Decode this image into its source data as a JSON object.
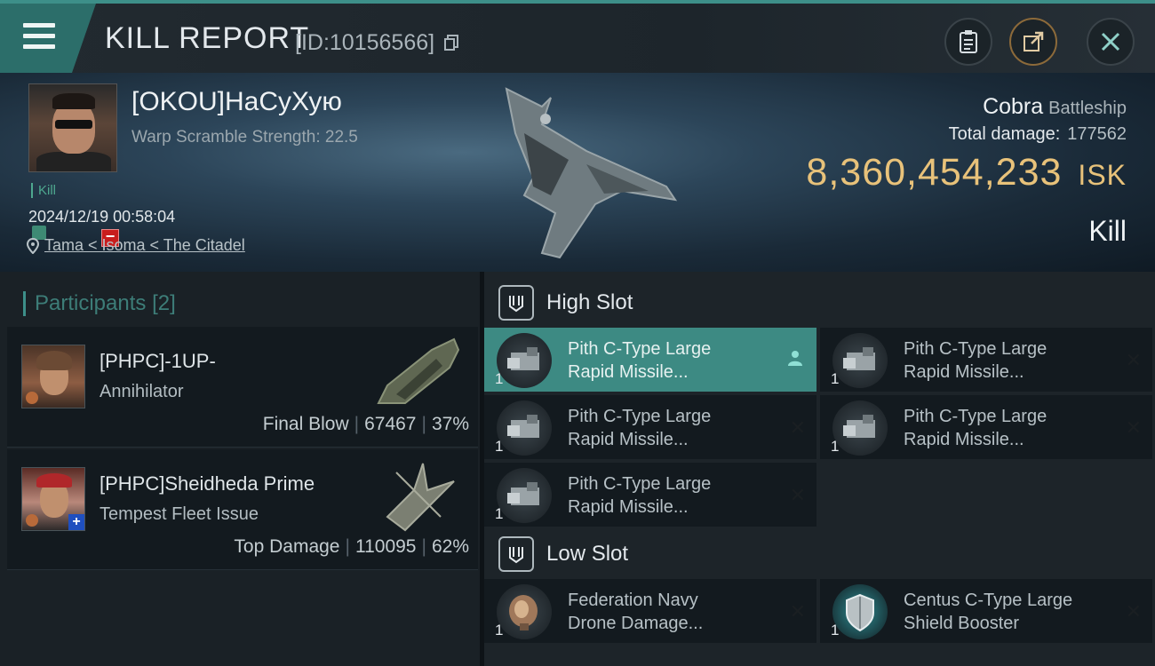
{
  "header": {
    "title": "KILL REPORT",
    "report_id": "[ID:10156566]"
  },
  "victim": {
    "name": "[OKOU]НаСуХую",
    "warp_scramble": "Warp Scramble Strength: 22.5",
    "tag": "Kill",
    "datetime": "2024/12/19 00:58:04",
    "location": "Tama < Isoma < The Citadel",
    "ship_name": "Cobra",
    "ship_class": "Battleship",
    "total_damage_label": "Total damage:",
    "total_damage": "177562",
    "isk_value": "8,360,454,233",
    "isk_unit": "ISK",
    "result": "Kill"
  },
  "participants": {
    "label": "Participants",
    "count": "[2]",
    "rows": [
      {
        "name": "[PHPC]-1UP-",
        "ship": "Annihilator",
        "stat_label": "Final Blow",
        "damage": "67467",
        "percent": "37%"
      },
      {
        "name": "[PHPC]Sheidheda Prime",
        "ship": "Tempest Fleet Issue",
        "stat_label": "Top Damage",
        "damage": "110095",
        "percent": "62%"
      }
    ]
  },
  "high_slot": {
    "title": "High Slot",
    "modules": [
      {
        "line1": "Pith C-Type Large",
        "line2": "Rapid Missile...",
        "qty": "1"
      },
      {
        "line1": "Pith C-Type Large",
        "line2": "Rapid Missile...",
        "qty": "1"
      },
      {
        "line1": "Pith C-Type Large",
        "line2": "Rapid Missile...",
        "qty": "1"
      },
      {
        "line1": "Pith C-Type Large",
        "line2": "Rapid Missile...",
        "qty": "1"
      },
      {
        "line1": "Pith C-Type Large",
        "line2": "Rapid Missile...",
        "qty": "1"
      }
    ]
  },
  "low_slot": {
    "title": "Low Slot",
    "modules": [
      {
        "line1": "Federation Navy",
        "line2": "Drone Damage...",
        "qty": "1"
      },
      {
        "line1": "Centus C-Type Large",
        "line2": "Shield Booster",
        "qty": "1"
      }
    ]
  },
  "icons": {
    "menu": "hamburger-icon",
    "copy": "copy-icon",
    "clipboard": "clipboard-icon",
    "share": "share-icon",
    "close": "close-icon",
    "location": "location-pin-icon",
    "slot": "slot-icon",
    "module_status_removed": "x-icon",
    "module_status_owner": "pilot-icon"
  },
  "colors": {
    "accent": "#3d8f89",
    "isk": "#e8c27a",
    "kill_tag": "#4ea88f",
    "minus_badge": "#c81d1d",
    "active_module": "#3d8a83"
  }
}
